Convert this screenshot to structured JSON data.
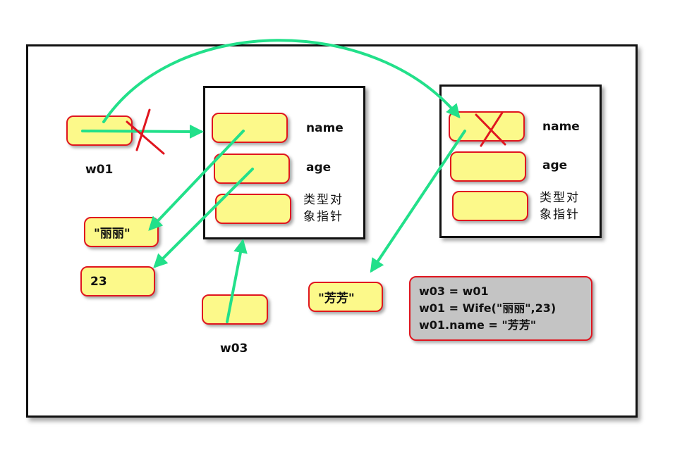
{
  "variables": {
    "w01": "w01",
    "w03": "w03"
  },
  "object_left": {
    "field_name": "name",
    "field_age": "age",
    "field_type_line1": "类型对",
    "field_type_line2": "象指针"
  },
  "object_right": {
    "field_name": "name",
    "field_age": "age",
    "field_type_line1": "类型对",
    "field_type_line2": "象指针"
  },
  "values": {
    "lili": "\"丽丽\"",
    "num23": "23",
    "fangfang": "\"芳芳\""
  },
  "code": {
    "line1": "w03 = w01",
    "line2": "w01 = Wife(\"丽丽\",23)",
    "line3": "w01.name = \"芳芳\""
  },
  "colors": {
    "arrow": "#22e08a",
    "cross": "#e0161f",
    "cell_fill": "#fcf98a",
    "cell_border": "#e0161f",
    "code_fill": "#c4c4c4"
  }
}
